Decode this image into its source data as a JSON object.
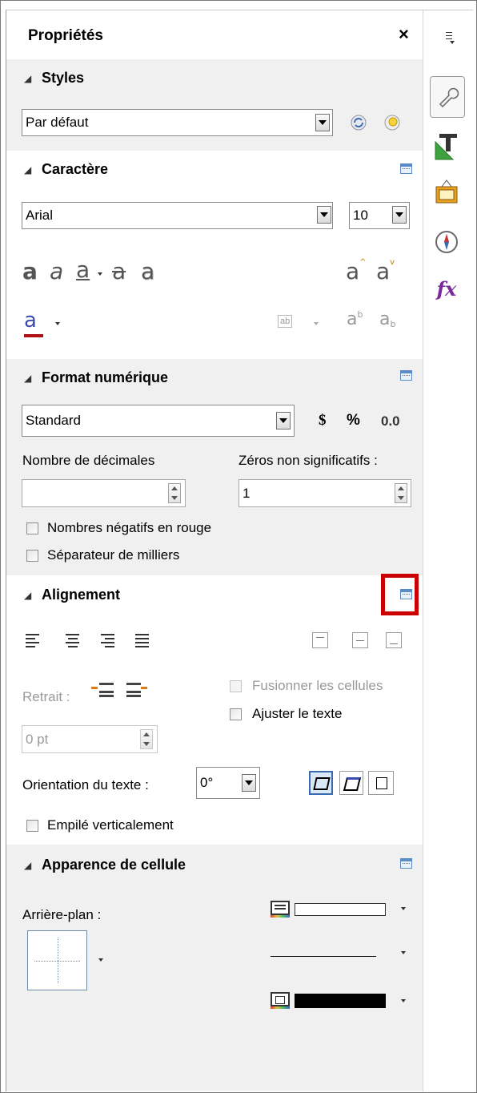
{
  "panel": {
    "title": "Propriétés",
    "close_glyph": "×",
    "menu_glyph": "≡"
  },
  "styles": {
    "header": "Styles",
    "value": "Par défaut",
    "update_icon": "refresh-style-icon",
    "new_icon": "new-style-icon"
  },
  "character": {
    "header": "Caractère",
    "font": "Arial",
    "size": "10",
    "highlight_sample": "ab",
    "spacing_sample": "ab"
  },
  "number_format": {
    "header": "Format numérique",
    "value": "Standard",
    "currency": "$",
    "percent": "%",
    "decimal": "0.0",
    "decimals_label": "Nombre de décimales",
    "leading_zeros_label": "Zéros non significatifs :",
    "decimals_value": "",
    "leading_zeros_value": "1",
    "negative_red_label": "Nombres négatifs en rouge",
    "thousands_sep_label": "Séparateur de milliers"
  },
  "alignment": {
    "header": "Alignement",
    "indent_label": "Retrait :",
    "indent_value": "0 pt",
    "merge_label": "Fusionner les cellules",
    "wrap_label": "Ajuster le texte",
    "orientation_label": "Orientation du texte :",
    "orientation_value": "0°",
    "stacked_label": "Empilé verticalement"
  },
  "cell_appearance": {
    "header": "Apparence de cellule",
    "background_label": "Arrière-plan :"
  },
  "colors": {
    "section_bg": "#f0f0f0",
    "highlight_box": "#cc0000",
    "accent_blue": "#3a6ab0",
    "font_color_bar": "#b01010"
  }
}
